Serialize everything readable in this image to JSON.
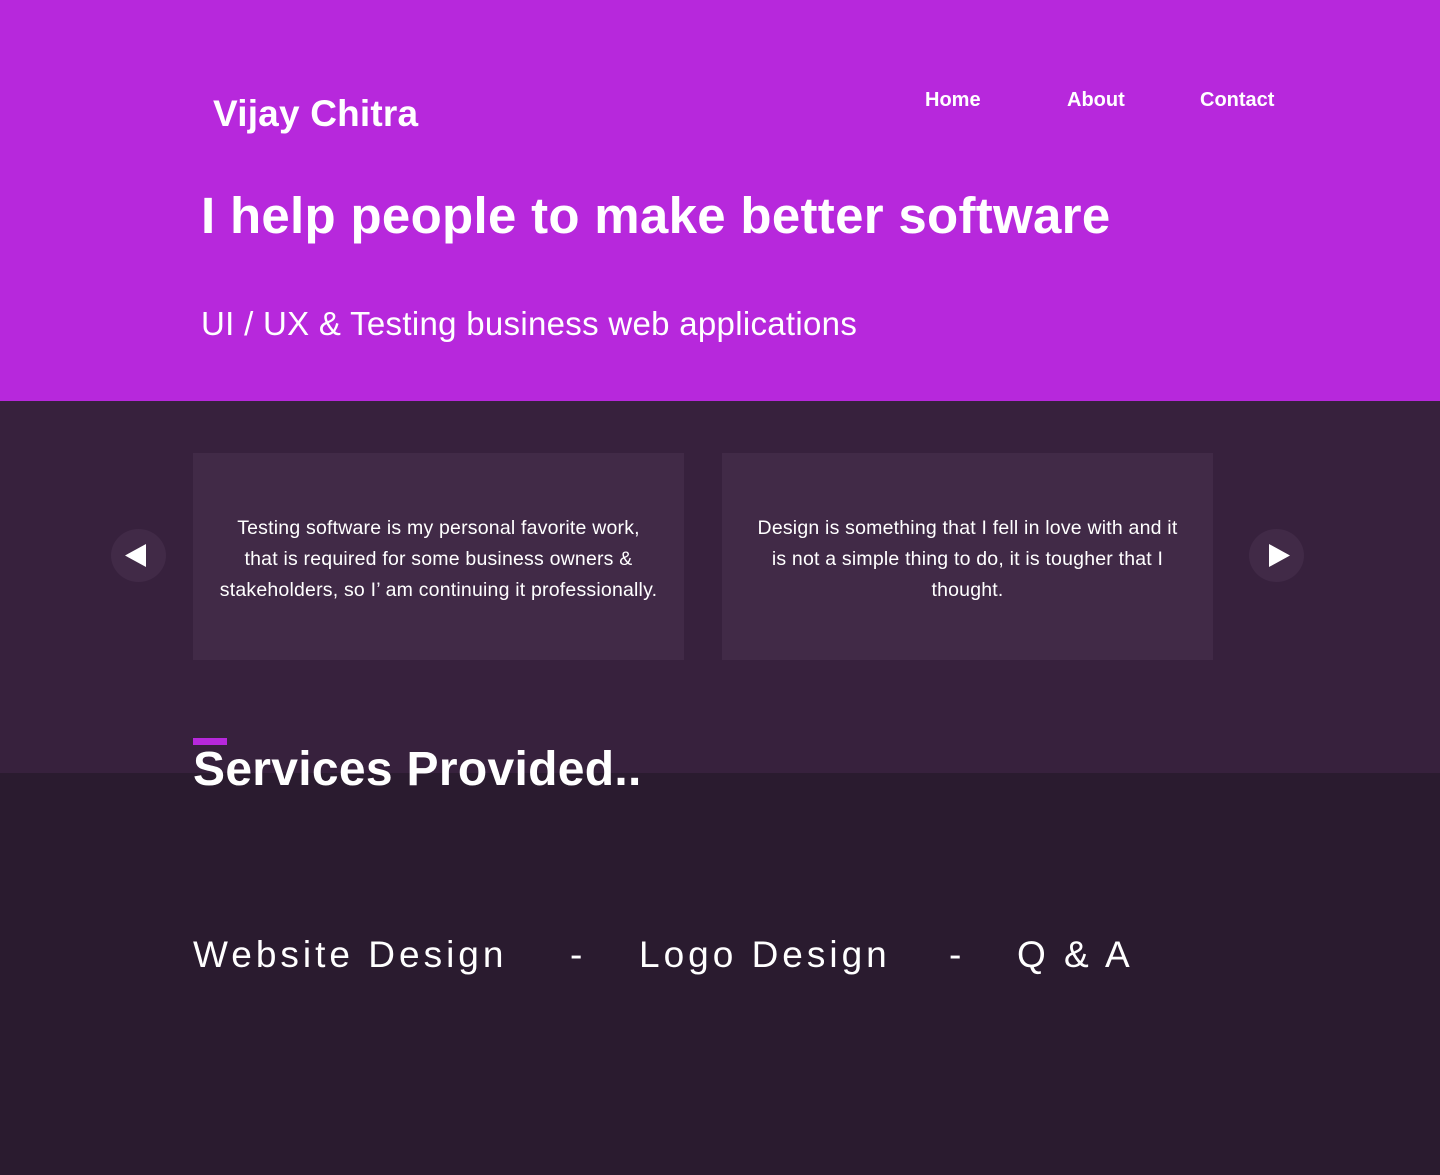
{
  "colors": {
    "hero_background": "#b728dc",
    "strip_background": "#37213d",
    "card_background": "#412a47",
    "page_background": "#2a1b2f",
    "text": "#ffffff",
    "accent": "#b728dc"
  },
  "header": {
    "brand": "Vijay Chitra",
    "nav": {
      "home": "Home",
      "about": "About",
      "contact": "Contact"
    }
  },
  "hero": {
    "headline": "I help people to make better software",
    "subline": "UI / UX & Testing business web applications"
  },
  "testimonials": {
    "prev_icon": "triangle-left-icon",
    "next_icon": "triangle-right-icon",
    "cards": [
      {
        "text": "Testing software is my personal favorite work, that is required for some business owners & stakeholders, so I’ am continuing it professionally."
      },
      {
        "text": "Design is something that I fell in love with and it is not a simple thing to do, it is tougher that I thought."
      }
    ]
  },
  "services": {
    "title": "Services Provided..",
    "items": [
      "Website Design",
      "Logo Design",
      "Q & A"
    ],
    "separator": "-"
  }
}
